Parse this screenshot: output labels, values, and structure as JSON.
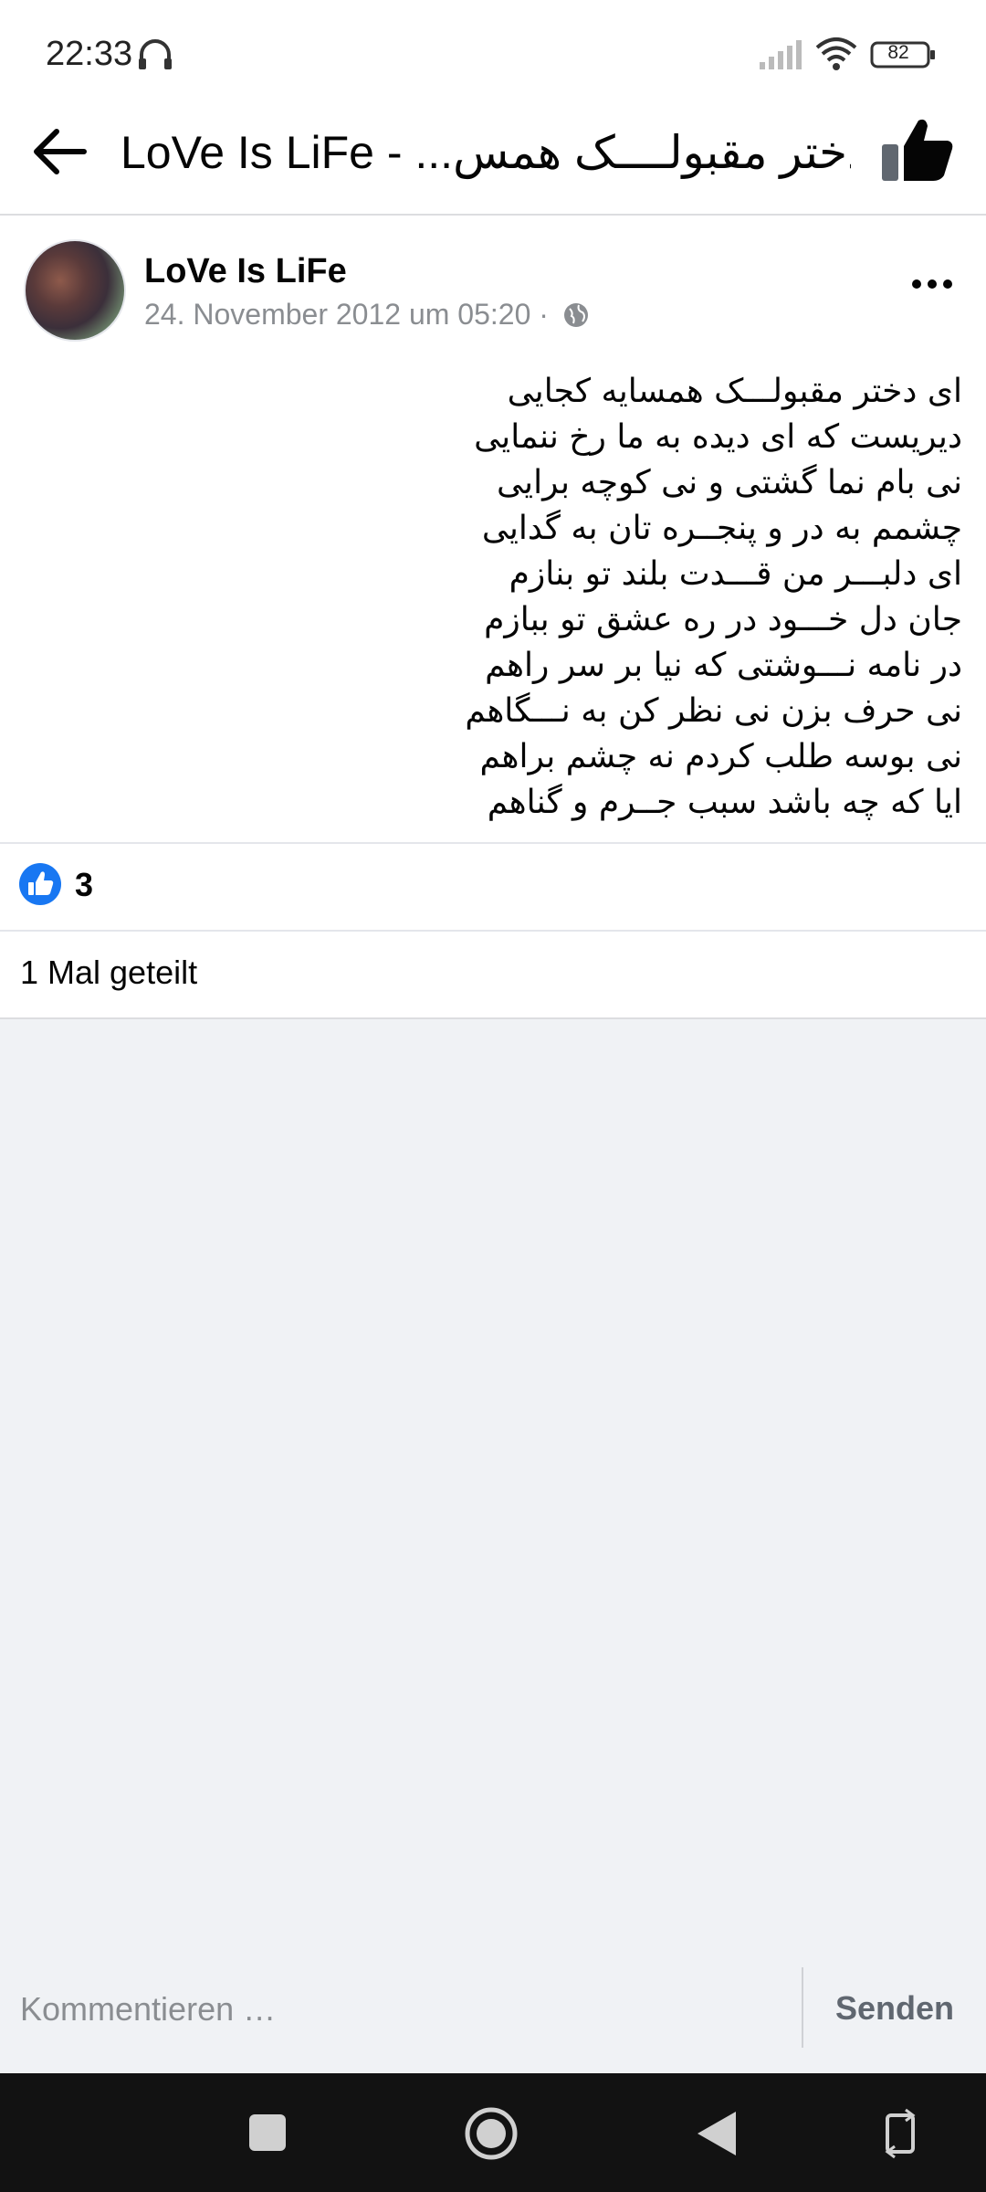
{
  "status_bar": {
    "time": "22:33",
    "battery": "82",
    "icons": [
      "headphone-icon",
      "signal-icon",
      "wifi-icon",
      "battery-icon"
    ]
  },
  "header": {
    "title": "LoVe Is LiFe - ...ای دختر مقبولــــک همس",
    "back_icon": "back-arrow-icon",
    "like_icon": "thumbs-up-icon"
  },
  "post": {
    "author": "LoVe Is LiFe",
    "meta": "24. November 2012 um 05:20 ·",
    "privacy_icon": "globe-icon",
    "more_icon": "more-options-icon",
    "lines": [
      "ای دختر مقبولـــک همسایه کجایی",
      "دیریست که ای دیده به ما رخ ننمایی",
      "نی بام نما گشتی و نی کوچه برایی",
      "چشمم به در و پنجــره تان به گدایی",
      "ای دلبـــر من قـــدت بلند تو بنازم",
      "جان دل خـــود در ره عشق تو ببازم",
      "در نامه نـــوشتی که نیا بر سر راهم",
      "نی حرف بزن نی نظر کن به نـــگاهم",
      "نی بوسه طلب کردم نه چشم براهم",
      "ایا که چه باشد سبب جــرم و گناهم"
    ]
  },
  "reactions": {
    "like_count": "3",
    "shares": "1 Mal geteilt"
  },
  "comment": {
    "placeholder": "Kommentieren …",
    "send_label": "Senden"
  },
  "colors": {
    "background": "#f0f2f5",
    "like_blue": "#1877f2",
    "muted_text": "#8a8d91",
    "nav_bar": "#121212"
  }
}
